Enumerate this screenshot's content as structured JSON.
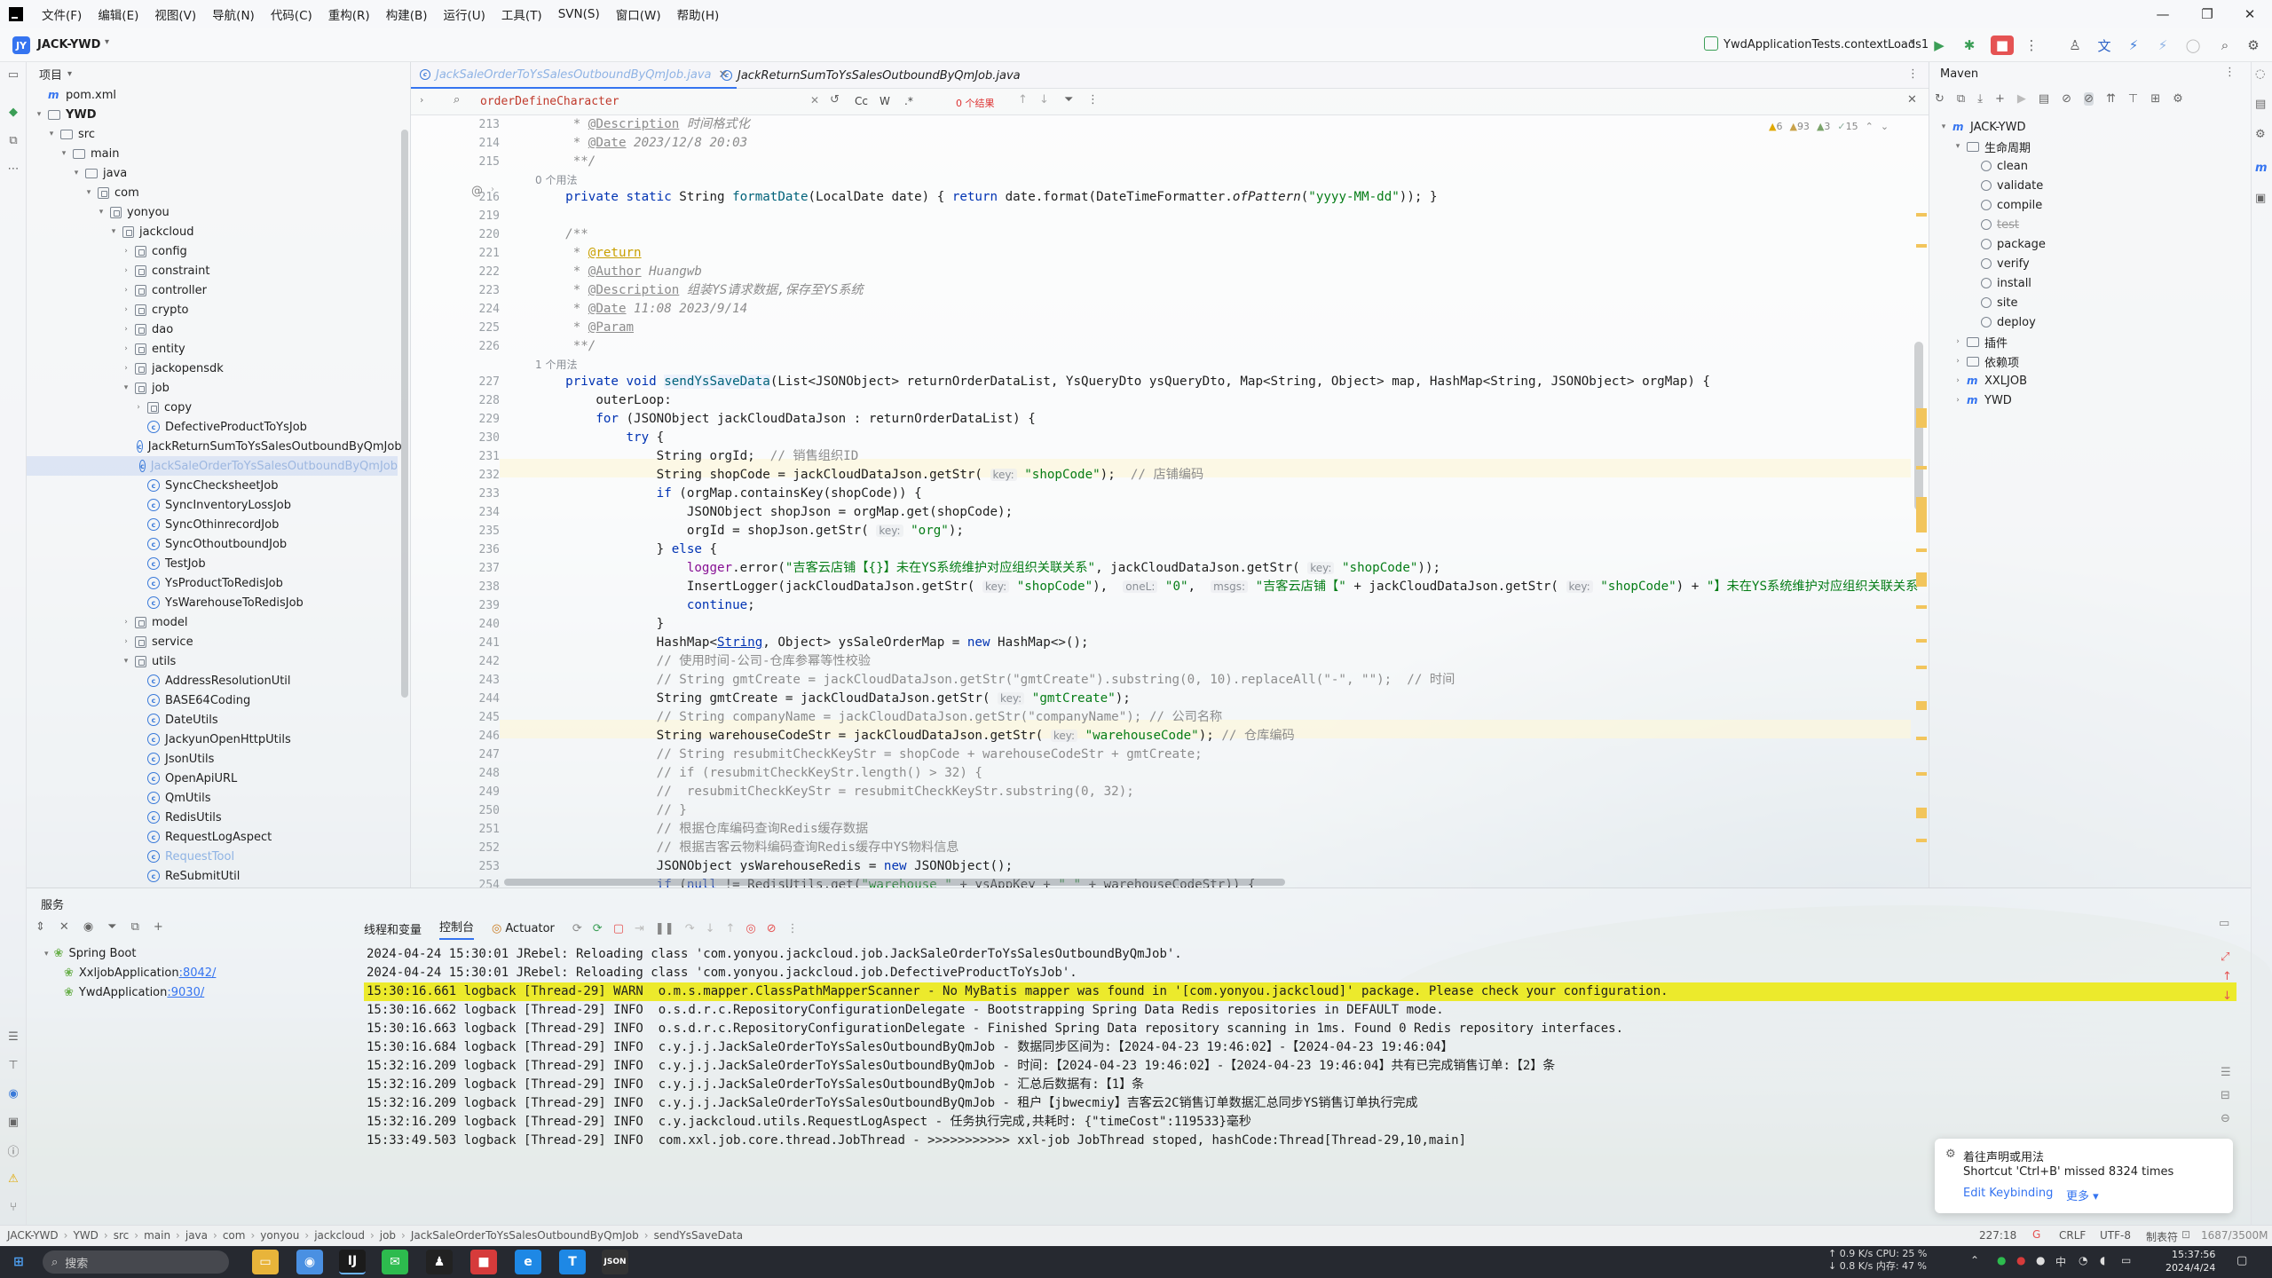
{
  "menubar": {
    "items": [
      "文件(F)",
      "编辑(E)",
      "视图(V)",
      "导航(N)",
      "代码(C)",
      "重构(R)",
      "构建(B)",
      "运行(U)",
      "工具(T)",
      "SVN(S)",
      "窗口(W)",
      "帮助(H)"
    ]
  },
  "toolbar": {
    "project_badge": "JY",
    "project_name": "JACK-YWD",
    "run_config": "YwdApplicationTests.contextLoads1"
  },
  "project_panel": {
    "title": "项目",
    "rows": [
      {
        "label": "pom.xml",
        "icon": "maven-file-icon",
        "indent": 0,
        "arrow": ""
      },
      {
        "label": "YWD",
        "icon": "folder-icon",
        "indent": 0,
        "arrow": "▾",
        "bold": true
      },
      {
        "label": "src",
        "icon": "folder-icon",
        "indent": 1,
        "arrow": "▾"
      },
      {
        "label": "main",
        "icon": "folder-icon",
        "indent": 2,
        "arrow": "▾"
      },
      {
        "label": "java",
        "icon": "folder-icon",
        "indent": 3,
        "arrow": "▾"
      },
      {
        "label": "com",
        "icon": "package-icon",
        "indent": 4,
        "arrow": "▾"
      },
      {
        "label": "yonyou",
        "icon": "package-icon",
        "indent": 5,
        "arrow": "▾"
      },
      {
        "label": "jackcloud",
        "icon": "package-icon",
        "indent": 6,
        "arrow": "▾"
      },
      {
        "label": "config",
        "icon": "package-icon",
        "indent": 7,
        "arrow": "›"
      },
      {
        "label": "constraint",
        "icon": "package-icon",
        "indent": 7,
        "arrow": "›"
      },
      {
        "label": "controller",
        "icon": "package-icon",
        "indent": 7,
        "arrow": "›"
      },
      {
        "label": "crypto",
        "icon": "package-icon",
        "indent": 7,
        "arrow": "›"
      },
      {
        "label": "dao",
        "icon": "package-icon",
        "indent": 7,
        "arrow": "›"
      },
      {
        "label": "entity",
        "icon": "package-icon",
        "indent": 7,
        "arrow": "›"
      },
      {
        "label": "jackopensdk",
        "icon": "package-icon",
        "indent": 7,
        "arrow": "›"
      },
      {
        "label": "job",
        "icon": "package-icon",
        "indent": 7,
        "arrow": "▾"
      },
      {
        "label": "copy",
        "icon": "package-icon",
        "indent": 8,
        "arrow": "›"
      },
      {
        "label": "DefectiveProductToYsJob",
        "icon": "class-icon",
        "indent": 8,
        "arrow": ""
      },
      {
        "label": "JackReturnSumToYsSalesOutboundByQmJob",
        "icon": "class-icon",
        "indent": 8,
        "arrow": ""
      },
      {
        "label": "JackSaleOrderToYsSalesOutboundByQmJob",
        "icon": "class-icon",
        "indent": 8,
        "arrow": "",
        "selected": true
      },
      {
        "label": "SyncChecksheetJob",
        "icon": "class-icon",
        "indent": 8,
        "arrow": ""
      },
      {
        "label": "SyncInventoryLossJob",
        "icon": "class-icon",
        "indent": 8,
        "arrow": ""
      },
      {
        "label": "SyncOthinrecordJob",
        "icon": "class-icon",
        "indent": 8,
        "arrow": ""
      },
      {
        "label": "SyncOthoutboundJob",
        "icon": "class-icon",
        "indent": 8,
        "arrow": ""
      },
      {
        "label": "TestJob",
        "icon": "class-icon",
        "indent": 8,
        "arrow": ""
      },
      {
        "label": "YsProductToRedisJob",
        "icon": "class-icon",
        "indent": 8,
        "arrow": ""
      },
      {
        "label": "YsWarehouseToRedisJob",
        "icon": "class-icon",
        "indent": 8,
        "arrow": ""
      },
      {
        "label": "model",
        "icon": "package-icon",
        "indent": 7,
        "arrow": "›"
      },
      {
        "label": "service",
        "icon": "package-icon",
        "indent": 7,
        "arrow": "›"
      },
      {
        "label": "utils",
        "icon": "package-icon",
        "indent": 7,
        "arrow": "▾"
      },
      {
        "label": "AddressResolutionUtil",
        "icon": "class-icon",
        "indent": 8,
        "arrow": ""
      },
      {
        "label": "BASE64Coding",
        "icon": "class-icon",
        "indent": 8,
        "arrow": ""
      },
      {
        "label": "DateUtils",
        "icon": "class-icon",
        "indent": 8,
        "arrow": ""
      },
      {
        "label": "JackyunOpenHttpUtils",
        "icon": "class-icon",
        "indent": 8,
        "arrow": ""
      },
      {
        "label": "JsonUtils",
        "icon": "class-icon",
        "indent": 8,
        "arrow": ""
      },
      {
        "label": "OpenApiURL",
        "icon": "class-icon",
        "indent": 8,
        "arrow": ""
      },
      {
        "label": "QmUtils",
        "icon": "class-icon",
        "indent": 8,
        "arrow": ""
      },
      {
        "label": "RedisUtils",
        "icon": "class-icon",
        "indent": 8,
        "arrow": ""
      },
      {
        "label": "RequestLogAspect",
        "icon": "class-icon",
        "indent": 8,
        "arrow": ""
      },
      {
        "label": "RequestTool",
        "icon": "class-icon",
        "indent": 8,
        "arrow": "",
        "faded": true
      },
      {
        "label": "ReSubmitUtil",
        "icon": "class-icon",
        "indent": 8,
        "arrow": ""
      }
    ]
  },
  "editor": {
    "tabs": [
      {
        "label": "JackSaleOrderToYsSalesOutboundByQmJob.java",
        "active": true
      },
      {
        "label": "JackReturnSumToYsSalesOutboundByQmJob.java",
        "active": false
      }
    ],
    "find": {
      "query": "orderDefineCharacter",
      "opt_cc": "Cc",
      "opt_w": "W",
      "opt_regex": ".*",
      "results": "0 个结果"
    },
    "inspections": {
      "warnings": "6",
      "weak": "93",
      "typos": "3",
      "other": "15"
    },
    "line_numbers": [
      "213",
      "214",
      "215",
      "",
      "216",
      "219",
      "220",
      "221",
      "222",
      "223",
      "224",
      "225",
      "226",
      "",
      "227",
      "228",
      "229",
      "230",
      "231",
      "232",
      "233",
      "234",
      "235",
      "236",
      "237",
      "238",
      "239",
      "240",
      "241",
      "242",
      "243",
      "244",
      "245",
      "246",
      "247",
      "248",
      "249",
      "250",
      "251",
      "252",
      "253",
      "254"
    ],
    "usage_hint_1": "0 个用法",
    "usage_hint_2": "1 个用法",
    "param_hints": {
      "key": "key:",
      "oneL": "oneL:",
      "msgs": "msgs:"
    }
  },
  "maven": {
    "title": "Maven",
    "rows": [
      {
        "label": "JACK-YWD",
        "kind": "root"
      },
      {
        "label": "生命周期",
        "kind": "folder"
      },
      {
        "label": "clean",
        "kind": "goal"
      },
      {
        "label": "validate",
        "kind": "goal"
      },
      {
        "label": "compile",
        "kind": "goal"
      },
      {
        "label": "test",
        "kind": "goal-disabled"
      },
      {
        "label": "package",
        "kind": "goal"
      },
      {
        "label": "verify",
        "kind": "goal"
      },
      {
        "label": "install",
        "kind": "goal"
      },
      {
        "label": "site",
        "kind": "goal"
      },
      {
        "label": "deploy",
        "kind": "goal"
      },
      {
        "label": "插件",
        "kind": "folder-closed"
      },
      {
        "label": "依赖项",
        "kind": "folder-closed"
      },
      {
        "label": "XXLJOB",
        "kind": "module"
      },
      {
        "label": "YWD",
        "kind": "module"
      }
    ]
  },
  "services": {
    "title": "服务",
    "tree": [
      {
        "label": "Spring Boot",
        "port": ""
      },
      {
        "label": "XxljobApplication",
        "port": ":8042/"
      },
      {
        "label": "YwdApplication",
        "port": ":9030/"
      }
    ],
    "console_tabs": [
      "线程和变量",
      "控制台",
      "Actuator"
    ],
    "log_lines": [
      {
        "text": "2024-04-24 15:30:01 JRebel: Reloading class 'com.yonyou.jackcloud.job.JackSaleOrderToYsSalesOutboundByQmJob'.",
        "warn": false
      },
      {
        "text": "2024-04-24 15:30:01 JRebel: Reloading class 'com.yonyou.jackcloud.job.DefectiveProductToYsJob'.",
        "warn": false
      },
      {
        "text": "15:30:16.661 logback [Thread-29] WARN  o.m.s.mapper.ClassPathMapperScanner - No MyBatis mapper was found in '[com.yonyou.jackcloud]' package. Please check your configuration.",
        "warn": true
      },
      {
        "text": "15:30:16.662 logback [Thread-29] INFO  o.s.d.r.c.RepositoryConfigurationDelegate - Bootstrapping Spring Data Redis repositories in DEFAULT mode.",
        "warn": false
      },
      {
        "text": "15:30:16.663 logback [Thread-29] INFO  o.s.d.r.c.RepositoryConfigurationDelegate - Finished Spring Data repository scanning in 1ms. Found 0 Redis repository interfaces.",
        "warn": false
      },
      {
        "text": "15:30:16.684 logback [Thread-29] INFO  c.y.j.j.JackSaleOrderToYsSalesOutboundByQmJob - 数据同步区间为:【2024-04-23 19:46:02】-【2024-04-23 19:46:04】",
        "warn": false
      },
      {
        "text": "15:32:16.209 logback [Thread-29] INFO  c.y.j.j.JackSaleOrderToYsSalesOutboundByQmJob - 时间:【2024-04-23 19:46:02】-【2024-04-23 19:46:04】共有已完成销售订单:【2】条",
        "warn": false
      },
      {
        "text": "15:32:16.209 logback [Thread-29] INFO  c.y.j.j.JackSaleOrderToYsSalesOutboundByQmJob - 汇总后数据有:【1】条",
        "warn": false
      },
      {
        "text": "15:32:16.209 logback [Thread-29] INFO  c.y.j.j.JackSaleOrderToYsSalesOutboundByQmJob - 租户【jbwecmiy】吉客云2C销售订单数据汇总同步YS销售订单执行完成",
        "warn": false
      },
      {
        "text": "15:32:16.209 logback [Thread-29] INFO  c.y.jackcloud.utils.RequestLogAspect - 任务执行完成,共耗时: {\"timeCost\":119533}毫秒",
        "warn": false
      },
      {
        "text": "15:33:49.503 logback [Thread-29] INFO  com.xxl.job.core.thread.JobThread - >>>>>>>>>>> xxl-job JobThread stoped, hashCode:Thread[Thread-29,10,main]",
        "warn": false
      }
    ]
  },
  "notification": {
    "title": "着往声明或用法",
    "body": "Shortcut 'Ctrl+B' missed 8324 times",
    "action": "Edit Keybinding",
    "more": "更多 ▾"
  },
  "statusbar": {
    "breadcrumb": [
      "JACK-YWD",
      "YWD",
      "src",
      "main",
      "java",
      "com",
      "yonyou",
      "jackcloud",
      "job",
      "JackSaleOrderToYsSalesOutboundByQmJob",
      "sendYsSaveData"
    ],
    "position": "227:18",
    "line_sep": "CRLF",
    "encoding": "UTF-8",
    "extra": "制表符",
    "memory": "1687/3500M"
  },
  "taskbar": {
    "search_placeholder": "搜索",
    "net_up": "0.9 K/s",
    "net_down": "0.8 K/s",
    "cpu": "CPU: 25 %",
    "ram": "内存: 47 %",
    "time": "15:37:56",
    "date": "2024/4/24"
  }
}
